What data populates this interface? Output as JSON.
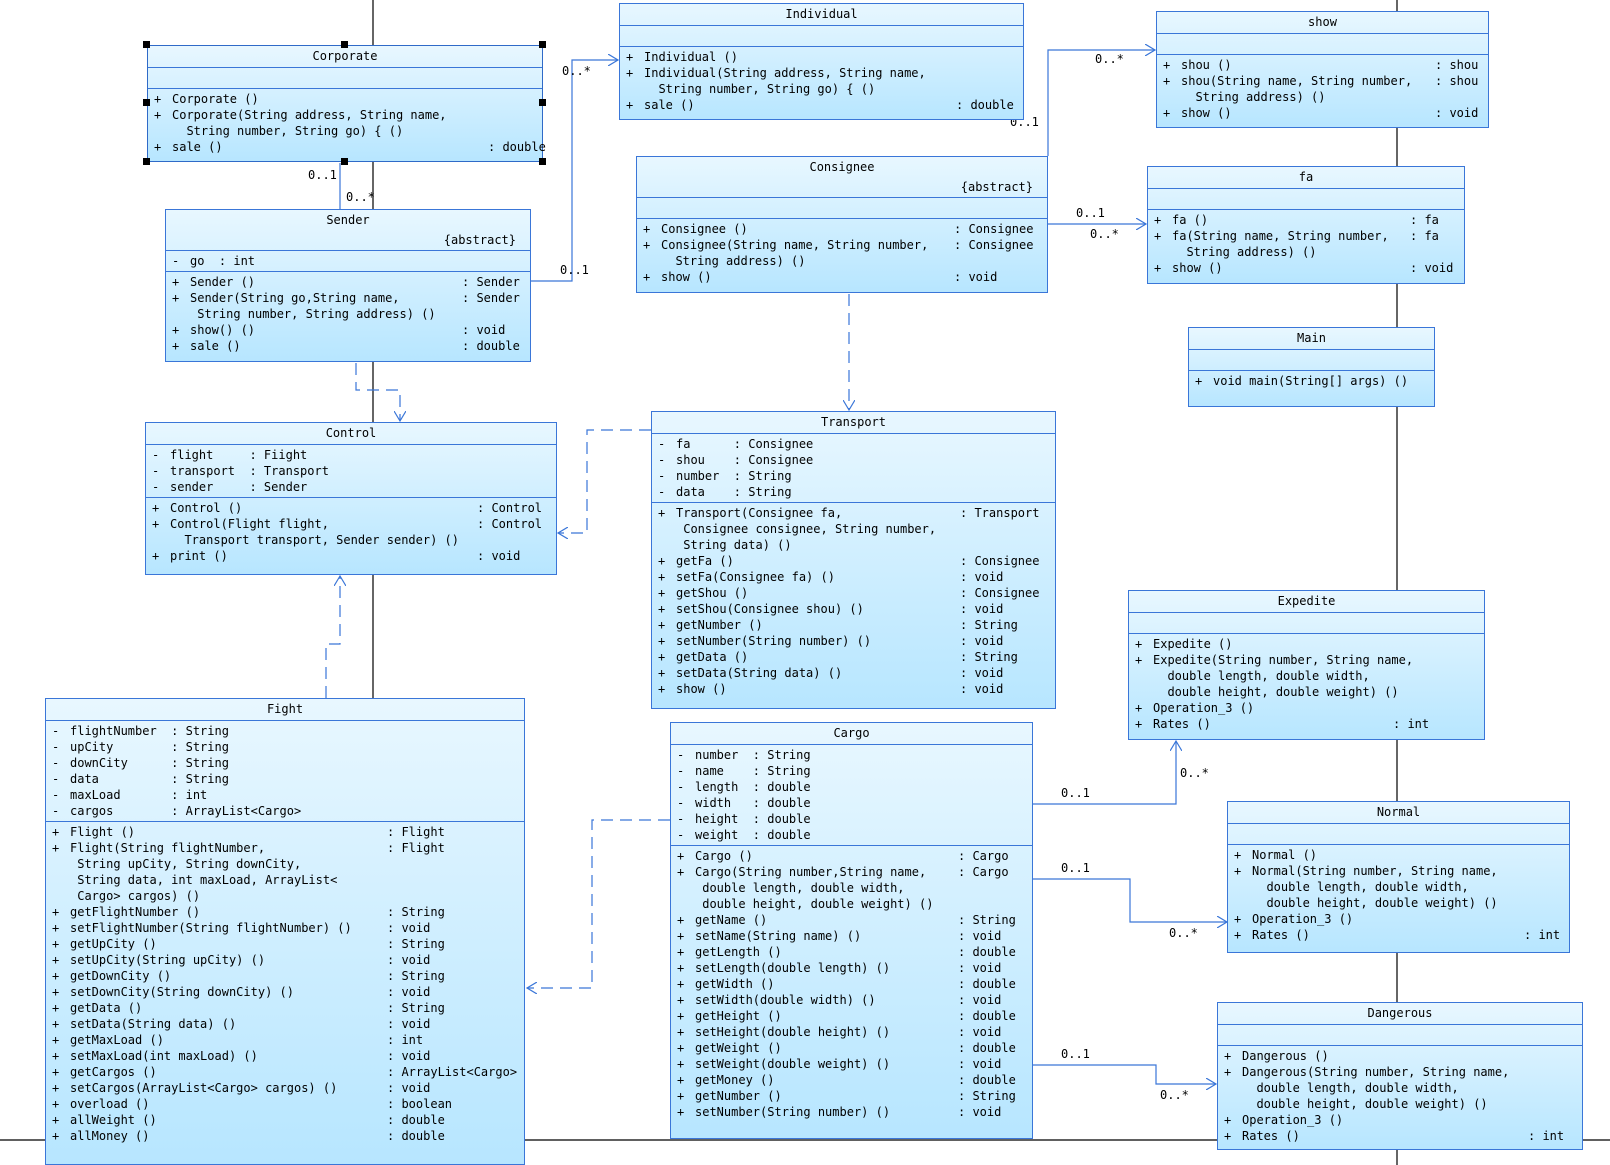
{
  "classes": {
    "corporate": {
      "name": "Corporate",
      "attrs": [],
      "ops": [
        {
          "vis": "+",
          "text": "Corporate ()",
          "ret": ""
        },
        {
          "vis": "+",
          "text": "Corporate(String address, String name,",
          "ret": ""
        },
        {
          "vis": "",
          "text": "  String number, String go) { ()",
          "ret": ""
        },
        {
          "vis": "+",
          "text": "sale ()",
          "ret": ": double"
        }
      ]
    },
    "individual": {
      "name": "Individual",
      "attrs": [],
      "ops": [
        {
          "vis": "+",
          "text": "Individual ()",
          "ret": ""
        },
        {
          "vis": "+",
          "text": "Individual(String address, String name,",
          "ret": ""
        },
        {
          "vis": "",
          "text": "  String number, String go) { ()",
          "ret": ""
        },
        {
          "vis": "+",
          "text": "sale ()",
          "ret": ": double"
        }
      ]
    },
    "show": {
      "name": "show",
      "attrs": [],
      "ops": [
        {
          "vis": "+",
          "text": "shou ()",
          "ret": ": shou"
        },
        {
          "vis": "+",
          "text": "shou(String name, String number,",
          "ret": ": shou"
        },
        {
          "vis": "",
          "text": "  String address) ()",
          "ret": ""
        },
        {
          "vis": "+",
          "text": "show ()",
          "ret": ": void"
        }
      ]
    },
    "sender": {
      "name": "Sender",
      "stereotype": "{abstract}",
      "attrs": [
        {
          "vis": "-",
          "text": "go  : int",
          "ret": ""
        }
      ],
      "ops": [
        {
          "vis": "+",
          "text": "Sender ()",
          "ret": ": Sender"
        },
        {
          "vis": "+",
          "text": "Sender(String go,String name,",
          "ret": ": Sender"
        },
        {
          "vis": "",
          "text": " String number, String address) ()",
          "ret": ""
        },
        {
          "vis": "+",
          "text": "show() ()",
          "ret": ": void"
        },
        {
          "vis": "+",
          "text": "sale ()",
          "ret": ": double"
        }
      ]
    },
    "consignee": {
      "name": "Consignee",
      "stereotype": "{abstract}",
      "attrs": [],
      "ops": [
        {
          "vis": "+",
          "text": "Consignee ()",
          "ret": ": Consignee"
        },
        {
          "vis": "+",
          "text": "Consignee(String name, String number,",
          "ret": ": Consignee"
        },
        {
          "vis": "",
          "text": "  String address) ()",
          "ret": ""
        },
        {
          "vis": "+",
          "text": "show ()",
          "ret": ": void"
        }
      ]
    },
    "fa": {
      "name": "fa",
      "attrs": [],
      "ops": [
        {
          "vis": "+",
          "text": "fa ()",
          "ret": ": fa"
        },
        {
          "vis": "+",
          "text": "fa(String name, String number,",
          "ret": ": fa"
        },
        {
          "vis": "",
          "text": "  String address) ()",
          "ret": ""
        },
        {
          "vis": "+",
          "text": "show ()",
          "ret": ": void"
        }
      ]
    },
    "main": {
      "name": "Main",
      "attrs": [],
      "ops": [
        {
          "vis": "+",
          "text": "void main(String[] args) ()",
          "ret": ""
        }
      ]
    },
    "control": {
      "name": "Control",
      "attrs": [
        {
          "vis": "-",
          "text": "flight     : Fiight",
          "ret": ""
        },
        {
          "vis": "-",
          "text": "transport  : Transport",
          "ret": ""
        },
        {
          "vis": "-",
          "text": "sender     : Sender",
          "ret": ""
        }
      ],
      "ops": [
        {
          "vis": "+",
          "text": "Control ()",
          "ret": ": Control"
        },
        {
          "vis": "+",
          "text": "Control(Flight flight,",
          "ret": ": Control"
        },
        {
          "vis": "",
          "text": "  Transport transport, Sender sender) ()",
          "ret": ""
        },
        {
          "vis": "+",
          "text": "print ()",
          "ret": ": void"
        }
      ]
    },
    "transport": {
      "name": "Transport",
      "attrs": [
        {
          "vis": "-",
          "text": "fa      : Consignee",
          "ret": ""
        },
        {
          "vis": "-",
          "text": "shou    : Consignee",
          "ret": ""
        },
        {
          "vis": "-",
          "text": "number  : String",
          "ret": ""
        },
        {
          "vis": "-",
          "text": "data    : String",
          "ret": ""
        }
      ],
      "ops": [
        {
          "vis": "+",
          "text": "Transport(Consignee fa,",
          "ret": ": Transport"
        },
        {
          "vis": "",
          "text": " Consignee consignee, String number,",
          "ret": ""
        },
        {
          "vis": "",
          "text": " String data) ()",
          "ret": ""
        },
        {
          "vis": "+",
          "text": "getFa ()",
          "ret": ": Consignee"
        },
        {
          "vis": "+",
          "text": "setFa(Consignee fa) ()",
          "ret": ": void"
        },
        {
          "vis": "+",
          "text": "getShou ()",
          "ret": ": Consignee"
        },
        {
          "vis": "+",
          "text": "setShou(Consignee shou) ()",
          "ret": ": void"
        },
        {
          "vis": "+",
          "text": "getNumber ()",
          "ret": ": String"
        },
        {
          "vis": "+",
          "text": "setNumber(String number) ()",
          "ret": ": void"
        },
        {
          "vis": "+",
          "text": "getData ()",
          "ret": ": String"
        },
        {
          "vis": "+",
          "text": "setData(String data) ()",
          "ret": ": void"
        },
        {
          "vis": "+",
          "text": "show ()",
          "ret": ": void"
        }
      ]
    },
    "expedite": {
      "name": "Expedite",
      "attrs": [],
      "ops": [
        {
          "vis": "+",
          "text": "Expedite ()",
          "ret": ""
        },
        {
          "vis": "+",
          "text": "Expedite(String number, String name,",
          "ret": ""
        },
        {
          "vis": "",
          "text": "  double length, double width,",
          "ret": ""
        },
        {
          "vis": "",
          "text": "  double height, double weight) ()",
          "ret": ""
        },
        {
          "vis": "+",
          "text": "Operation_3 ()",
          "ret": ""
        },
        {
          "vis": "+",
          "text": "Rates ()",
          "ret": ": int"
        }
      ]
    },
    "fight": {
      "name": "Fight",
      "attrs": [
        {
          "vis": "-",
          "text": "flightNumber  : String",
          "ret": ""
        },
        {
          "vis": "-",
          "text": "upCity        : String",
          "ret": ""
        },
        {
          "vis": "-",
          "text": "downCity      : String",
          "ret": ""
        },
        {
          "vis": "-",
          "text": "data          : String",
          "ret": ""
        },
        {
          "vis": "-",
          "text": "maxLoad       : int",
          "ret": ""
        },
        {
          "vis": "-",
          "text": "cargos        : ArrayList<Cargo>",
          "ret": ""
        }
      ],
      "ops": [
        {
          "vis": "+",
          "text": "Flight ()",
          "ret": ": Flight"
        },
        {
          "vis": "+",
          "text": "Flight(String flightNumber,",
          "ret": ": Flight"
        },
        {
          "vis": "",
          "text": " String upCity, String downCity,",
          "ret": ""
        },
        {
          "vis": "",
          "text": " String data, int maxLoad, ArrayList<",
          "ret": ""
        },
        {
          "vis": "",
          "text": " Cargo> cargos) ()",
          "ret": ""
        },
        {
          "vis": "+",
          "text": "getFlightNumber ()",
          "ret": ": String"
        },
        {
          "vis": "+",
          "text": "setFlightNumber(String flightNumber) ()",
          "ret": ": void"
        },
        {
          "vis": "+",
          "text": "getUpCity ()",
          "ret": ": String"
        },
        {
          "vis": "+",
          "text": "setUpCity(String upCity) ()",
          "ret": ": void"
        },
        {
          "vis": "+",
          "text": "getDownCity ()",
          "ret": ": String"
        },
        {
          "vis": "+",
          "text": "setDownCity(String downCity) ()",
          "ret": ": void"
        },
        {
          "vis": "+",
          "text": "getData ()",
          "ret": ": String"
        },
        {
          "vis": "+",
          "text": "setData(String data) ()",
          "ret": ": void"
        },
        {
          "vis": "+",
          "text": "getMaxLoad ()",
          "ret": ": int"
        },
        {
          "vis": "+",
          "text": "setMaxLoad(int maxLoad) ()",
          "ret": ": void"
        },
        {
          "vis": "+",
          "text": "getCargos ()",
          "ret": ": ArrayList<Cargo>"
        },
        {
          "vis": "+",
          "text": "setCargos(ArrayList<Cargo> cargos) ()",
          "ret": ": void"
        },
        {
          "vis": "+",
          "text": "overload ()",
          "ret": ": boolean"
        },
        {
          "vis": "+",
          "text": "allWeight ()",
          "ret": ": double"
        },
        {
          "vis": "+",
          "text": "allMoney ()",
          "ret": ": double"
        }
      ]
    },
    "cargo": {
      "name": "Cargo",
      "attrs": [
        {
          "vis": "-",
          "text": "number  : String",
          "ret": ""
        },
        {
          "vis": "-",
          "text": "name    : String",
          "ret": ""
        },
        {
          "vis": "-",
          "text": "length  : double",
          "ret": ""
        },
        {
          "vis": "-",
          "text": "width   : double",
          "ret": ""
        },
        {
          "vis": "-",
          "text": "height  : double",
          "ret": ""
        },
        {
          "vis": "-",
          "text": "weight  : double",
          "ret": ""
        }
      ],
      "ops": [
        {
          "vis": "+",
          "text": "Cargo ()",
          "ret": ": Cargo"
        },
        {
          "vis": "+",
          "text": "Cargo(String number,String name,",
          "ret": ": Cargo"
        },
        {
          "vis": "",
          "text": " double length, double width,",
          "ret": ""
        },
        {
          "vis": "",
          "text": " double height, double weight) ()",
          "ret": ""
        },
        {
          "vis": "+",
          "text": "getName ()",
          "ret": ": String"
        },
        {
          "vis": "+",
          "text": "setName(String name) ()",
          "ret": ": void"
        },
        {
          "vis": "+",
          "text": "getLength ()",
          "ret": ": double"
        },
        {
          "vis": "+",
          "text": "setLength(double length) ()",
          "ret": ": void"
        },
        {
          "vis": "+",
          "text": "getWidth ()",
          "ret": ": double"
        },
        {
          "vis": "+",
          "text": "setWidth(double width) ()",
          "ret": ": void"
        },
        {
          "vis": "+",
          "text": "getHeight ()",
          "ret": ": double"
        },
        {
          "vis": "+",
          "text": "setHeight(double height) ()",
          "ret": ": void"
        },
        {
          "vis": "+",
          "text": "getWeight ()",
          "ret": ": double"
        },
        {
          "vis": "+",
          "text": "setWeight(double weight) ()",
          "ret": ": void"
        },
        {
          "vis": "+",
          "text": "getMoney ()",
          "ret": ": double"
        },
        {
          "vis": "+",
          "text": "getNumber ()",
          "ret": ": String"
        },
        {
          "vis": "+",
          "text": "setNumber(String number) ()",
          "ret": ": void"
        }
      ]
    },
    "normal": {
      "name": "Normal",
      "attrs": [],
      "ops": [
        {
          "vis": "+",
          "text": "Normal ()",
          "ret": ""
        },
        {
          "vis": "+",
          "text": "Normal(String number, String name,",
          "ret": ""
        },
        {
          "vis": "",
          "text": "  double length, double width,",
          "ret": ""
        },
        {
          "vis": "",
          "text": "  double height, double weight) ()",
          "ret": ""
        },
        {
          "vis": "+",
          "text": "Operation_3 ()",
          "ret": ""
        },
        {
          "vis": "+",
          "text": "Rates ()",
          "ret": ": int"
        }
      ]
    },
    "dangerous": {
      "name": "Dangerous",
      "attrs": [],
      "ops": [
        {
          "vis": "+",
          "text": "Dangerous ()",
          "ret": ""
        },
        {
          "vis": "+",
          "text": "Dangerous(String number, String name,",
          "ret": ""
        },
        {
          "vis": "",
          "text": "  double length, double width,",
          "ret": ""
        },
        {
          "vis": "",
          "text": "  double height, double weight) ()",
          "ret": ""
        },
        {
          "vis": "+",
          "text": "Operation_3 ()",
          "ret": ""
        },
        {
          "vis": "+",
          "text": "Rates ()",
          "ret": ": int"
        }
      ]
    }
  },
  "multiplicities": {
    "corp_sender_top": "0..1",
    "corp_sender_bottom": "0..*",
    "sender_individual_src": "0..1",
    "sender_individual_dst": "0..*",
    "consignee_show_src": "0..1",
    "consignee_show_dst": "0..*",
    "consignee_fa_src": "0..1",
    "consignee_fa_dst": "0..*",
    "cargo_expedite_src": "0..1",
    "cargo_expedite_dst": "0..*",
    "cargo_normal_src": "0..1",
    "cargo_normal_dst": "0..*",
    "cargo_dangerous_src": "0..1",
    "cargo_dangerous_dst": "0..*"
  },
  "colors": {
    "line": "#3a76d8",
    "class_border": "#3a76d8",
    "gradient_top": "#e8f7ff",
    "gradient_bottom": "#b7e6ff",
    "lifeline": "#000000"
  }
}
